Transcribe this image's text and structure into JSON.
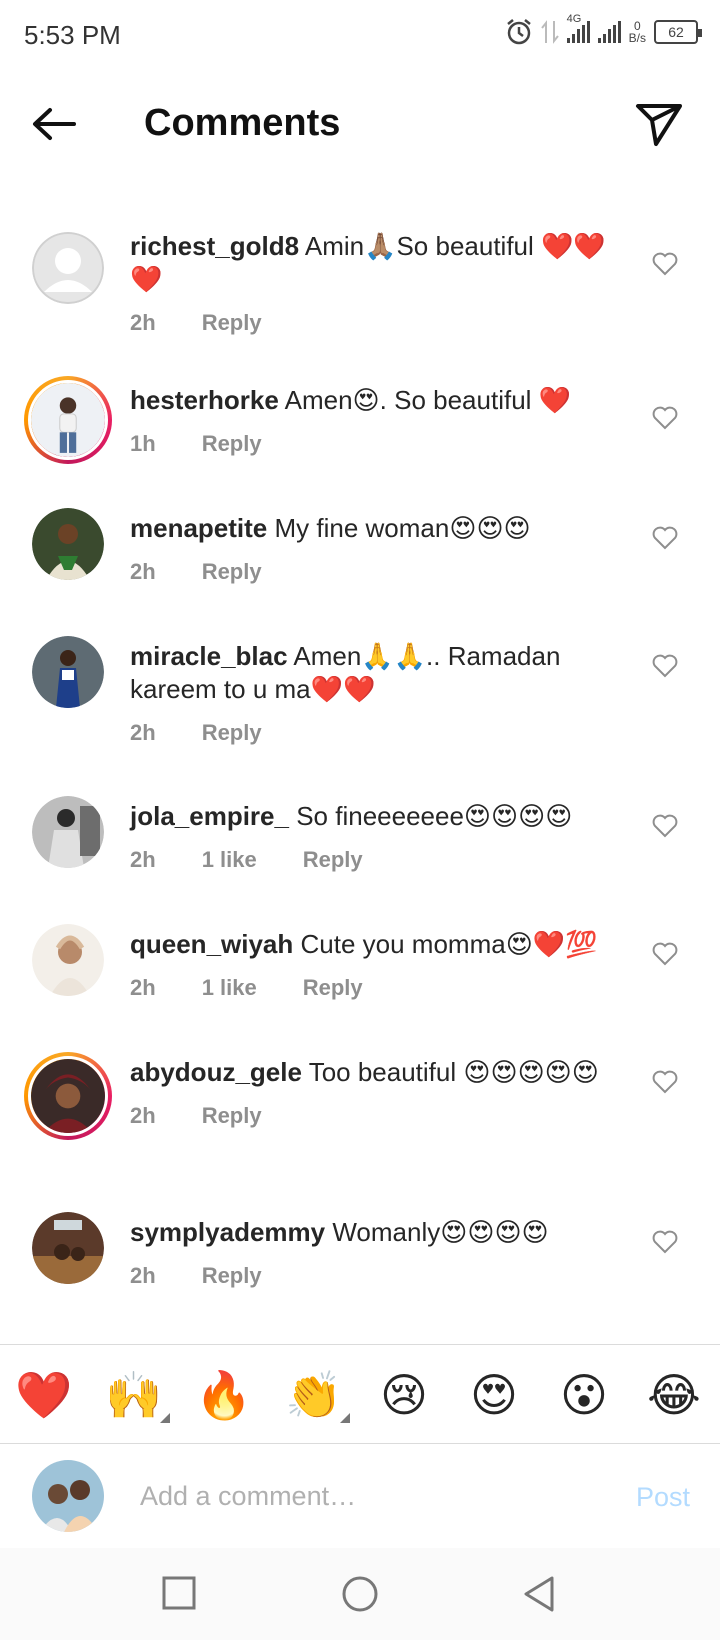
{
  "status": {
    "time": "5:53 PM",
    "network": "4G",
    "speed_value": "0",
    "speed_unit": "B/s",
    "battery": "62"
  },
  "header": {
    "title": "Comments"
  },
  "comments": [
    {
      "user": "richest_gold8",
      "text": "Amin🙏🏽So beautiful ❤️❤️❤️",
      "time": "2h",
      "likes": "",
      "reply": "Reply"
    },
    {
      "user": "hesterhorke",
      "text": "Amen😍. So beautiful ❤️",
      "time": "1h",
      "likes": "",
      "reply": "Reply"
    },
    {
      "user": "menapetite",
      "text": "My fine woman😍😍😍",
      "time": "2h",
      "likes": "",
      "reply": "Reply"
    },
    {
      "user": "miracle_blac",
      "text": "Amen🙏🙏.. Ramadan kareem to u ma❤️❤️",
      "time": "2h",
      "likes": "",
      "reply": "Reply"
    },
    {
      "user": "jola_empire_",
      "text": "So fineeeeeee😍😍😍😍",
      "time": "2h",
      "likes": "1 like",
      "reply": "Reply"
    },
    {
      "user": "queen_wiyah",
      "text": "Cute you momma😍❤️💯",
      "time": "2h",
      "likes": "1 like",
      "reply": "Reply"
    },
    {
      "user": "abydouz_gele",
      "text": "Too beautiful 😍😍😍😍😍",
      "time": "2h",
      "likes": "",
      "reply": "Reply"
    },
    {
      "user": "symplyademmy",
      "text": "Womanly😍😍😍😍",
      "time": "2h",
      "likes": "",
      "reply": "Reply"
    }
  ],
  "quick_emojis": [
    "❤️",
    "🙌",
    "🔥",
    "👏",
    "😢",
    "😍",
    "😮",
    "😂"
  ],
  "composer": {
    "placeholder": "Add a comment…",
    "post_label": "Post"
  },
  "colors": {
    "accent_disabled": "#b3dbff",
    "secondary_text": "#8e8e8e",
    "heart_red": "#ed4956"
  }
}
